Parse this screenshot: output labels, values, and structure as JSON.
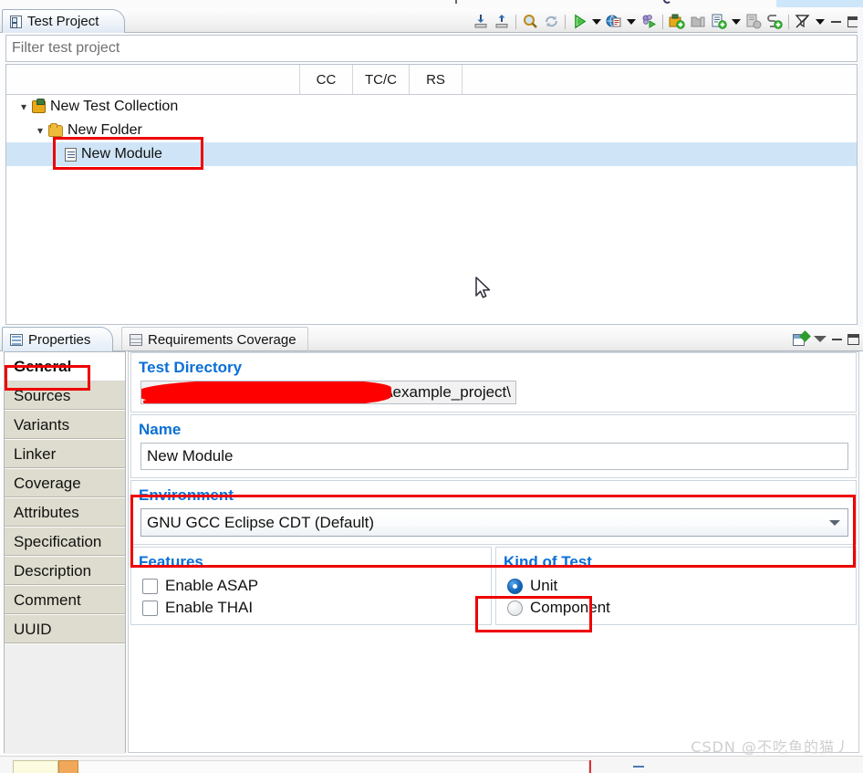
{
  "top_view": {
    "tab_label": "Test Project",
    "tab_icon": "test-project-icon",
    "filter_placeholder": "Filter test project",
    "columns": [
      "CC",
      "TC/C",
      "RS"
    ],
    "toolbar": [
      {
        "name": "collapse-all-icon",
        "label": "Collapse All"
      },
      {
        "name": "expand-all-icon",
        "label": "Expand All"
      },
      {
        "name": "search-icon",
        "label": "Search"
      },
      {
        "name": "refresh-icon",
        "label": "Refresh"
      },
      {
        "name": "run-icon",
        "label": "Run"
      },
      {
        "name": "run-dropdown-icon",
        "label": "Run Options"
      },
      {
        "name": "report-icon",
        "label": "Generate Report"
      },
      {
        "name": "report-dropdown-icon",
        "label": "Report Options"
      },
      {
        "name": "debug-icon",
        "label": "Debug"
      },
      {
        "name": "new-collection-icon",
        "label": "New Test Collection"
      },
      {
        "name": "new-folder-icon",
        "label": "New Folder"
      },
      {
        "name": "new-module-icon",
        "label": "New Module"
      },
      {
        "name": "new-module-dropdown-icon",
        "label": "New Module Options"
      },
      {
        "name": "new-document-icon",
        "label": "New Document"
      },
      {
        "name": "link-icon",
        "label": "Link"
      },
      {
        "name": "filter-icon",
        "label": "Filter"
      },
      {
        "name": "filter-dropdown-icon",
        "label": "Filter Options"
      },
      {
        "name": "minimize-icon",
        "label": "Minimize"
      },
      {
        "name": "maximize-icon",
        "label": "Maximize"
      }
    ],
    "tree": [
      {
        "label": "New Test Collection",
        "icon": "test-collection-icon",
        "depth": 0,
        "expanded": true,
        "selected": false
      },
      {
        "label": "New Folder",
        "icon": "folder-icon",
        "depth": 1,
        "expanded": true,
        "selected": false
      },
      {
        "label": "New Module",
        "icon": "module-icon",
        "depth": 2,
        "expanded": null,
        "selected": true
      }
    ]
  },
  "bottom_view": {
    "tabs": [
      {
        "label": "Properties",
        "icon": "properties-icon",
        "active": true
      },
      {
        "label": "Requirements Coverage",
        "icon": "requirements-coverage-icon",
        "active": false
      }
    ],
    "panel_tools": [
      {
        "name": "pin-editor-icon",
        "label": "Pin to Editor"
      },
      {
        "name": "view-menu-icon",
        "label": "View Menu"
      },
      {
        "name": "minimize-icon",
        "label": "Minimize"
      },
      {
        "name": "maximize-icon",
        "label": "Maximize"
      }
    ],
    "sidebar": [
      {
        "label": "General",
        "selected": true
      },
      {
        "label": "Sources",
        "selected": false
      },
      {
        "label": "Variants",
        "selected": false
      },
      {
        "label": "Linker",
        "selected": false
      },
      {
        "label": "Coverage",
        "selected": false
      },
      {
        "label": "Attributes",
        "selected": false
      },
      {
        "label": "Specification",
        "selected": false
      },
      {
        "label": "Description",
        "selected": false
      },
      {
        "label": "Comment",
        "selected": false
      },
      {
        "label": "UUID",
        "selected": false
      }
    ],
    "general": {
      "test_directory": {
        "label": "Test Directory",
        "value": "\\example_project\\",
        "redacted": true
      },
      "name": {
        "label": "Name",
        "value": "New Module"
      },
      "environment": {
        "label": "Environment",
        "value": "GNU GCC Eclipse CDT (Default)"
      },
      "features": {
        "label": "Features",
        "items": [
          {
            "label": "Enable ASAP",
            "checked": false
          },
          {
            "label": "Enable THAI",
            "checked": false
          }
        ]
      },
      "kind_of_test": {
        "label": "Kind of Test",
        "items": [
          {
            "label": "Unit",
            "selected": true
          },
          {
            "label": "Component",
            "selected": false
          }
        ]
      }
    }
  },
  "annotations": {
    "highlight_color": "#ee0000",
    "boxes": [
      "new-module-tree-node",
      "general-sidebar-item",
      "environment-group",
      "unit-radio-option"
    ]
  },
  "watermark": "CSDN @不吃鱼的猫丿"
}
